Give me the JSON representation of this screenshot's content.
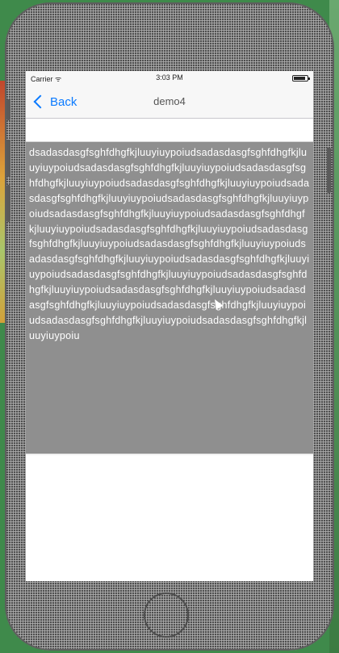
{
  "status_bar": {
    "carrier": "Carrier ᯤ",
    "time": "3:03 PM"
  },
  "nav_bar": {
    "back_label": "Back",
    "title": "demo4"
  },
  "text_view": {
    "content": "dsadasdasgfsghfdhgfkjluuyiuypoiudsadasdasgfsghfdhgfkjluuyiuypoiudsadasdasgfsghfdhgfkjluuyiuypoiudsadasdasgfsghfdhgfkjluuyiuypoiudsadasdasgfsghfdhgfkjluuyiuypoiudsadasdasgfsghfdhgfkjluuyiuypoiudsadasdasgfsghfdhgfkjluuyiuypoiudsadasdasgfsghfdhgfkjluuyiuypoiudsadasdasgfsghfdhgfkjluuyiuypoiudsadasdasgfsghfdhgfkjluuyiuypoiudsadasdasgfsghfdhgfkjluuyiuypoiudsadasdasgfsghfdhgfkjluuyiuypoiudsadasdasgfsghfdhgfkjluuyiuypoiudsadasdasgfsghfdhgfkjluuyiuypoiudsadasdasgfsghfdhgfkjluuyiuypoiudsadasdasgfsghfdhgfkjluuyiuypoiudsadasdasgfsghfdhgfkjluuyiuypoiudsadasdasgfsghfdhgfkjluuyiuypoiudsadasdasgfsghfdhgfkjluuyiuypoiudsadasdasgfsghfdhgfkjluuyiuypoiudsadasdasgfsghfdhgfkjluuyiuypoiu"
  },
  "colors": {
    "accent": "#0a7aff",
    "selection": "#8f8f8f",
    "device_frame": "#8d8d8d"
  }
}
